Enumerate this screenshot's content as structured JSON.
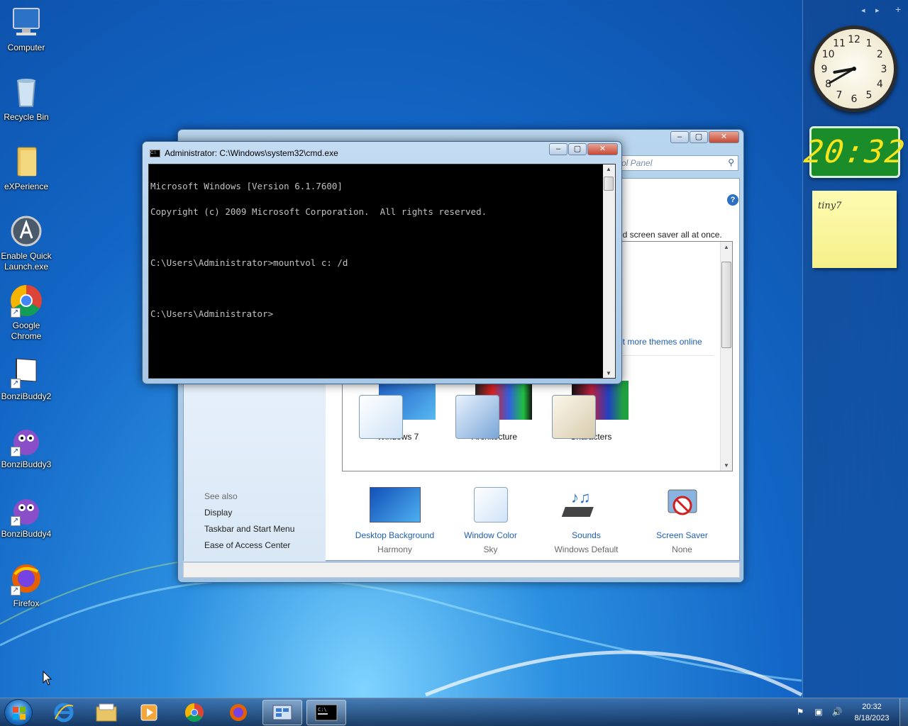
{
  "desktop": {
    "icons": [
      {
        "label": "Computer",
        "icon": "computer-icon"
      },
      {
        "label": "Recycle Bin",
        "icon": "recycle-bin-icon"
      },
      {
        "label": "eXPerience",
        "icon": "folder-icon"
      },
      {
        "label": "Enable Quick Launch.exe",
        "icon": "app-icon"
      },
      {
        "label": "Google Chrome",
        "icon": "chrome-icon"
      },
      {
        "label": "BonziBuddy2",
        "icon": "file-icon"
      },
      {
        "label": "BonziBuddy3",
        "icon": "bonzi-icon"
      },
      {
        "label": "BonziBuddy4",
        "icon": "bonzi-icon"
      },
      {
        "label": "Firefox",
        "icon": "firefox-icon"
      }
    ]
  },
  "gadgets": {
    "digital_clock": "20:32",
    "note_text": "tiny7",
    "analog_clock": {
      "hour": 8,
      "minute": 40
    }
  },
  "personalization": {
    "search_placeholder": "ol Panel",
    "description": "nd screen saver all at once.",
    "more_themes_link": "et more themes online",
    "themes": [
      {
        "name": "Windows 7"
      },
      {
        "name": "Architecture"
      },
      {
        "name": "Characters"
      }
    ],
    "see_also": {
      "header": "See also",
      "links": [
        "Display",
        "Taskbar and Start Menu",
        "Ease of Access Center"
      ]
    },
    "settings": [
      {
        "label": "Desktop Background",
        "value": "Harmony"
      },
      {
        "label": "Window Color",
        "value": "Sky"
      },
      {
        "label": "Sounds",
        "value": "Windows Default"
      },
      {
        "label": "Screen Saver",
        "value": "None"
      }
    ]
  },
  "cmd": {
    "title": "Administrator: C:\\Windows\\system32\\cmd.exe",
    "lines": [
      "Microsoft Windows [Version 6.1.7600]",
      "Copyright (c) 2009 Microsoft Corporation.  All rights reserved.",
      "",
      "C:\\Users\\Administrator>mountvol c: /d",
      "",
      "C:\\Users\\Administrator>"
    ]
  },
  "taskbar": {
    "items": [
      "internet-explorer-icon",
      "file-explorer-icon",
      "media-player-icon",
      "chrome-icon",
      "firefox-icon",
      "control-panel-icon",
      "cmd-icon"
    ],
    "time": "20:32",
    "date": "8/18/2023"
  },
  "colors": {
    "link_blue": "#1e5fb4",
    "clock_green": "#1a8d2a",
    "clock_digits": "#f8e41c"
  }
}
